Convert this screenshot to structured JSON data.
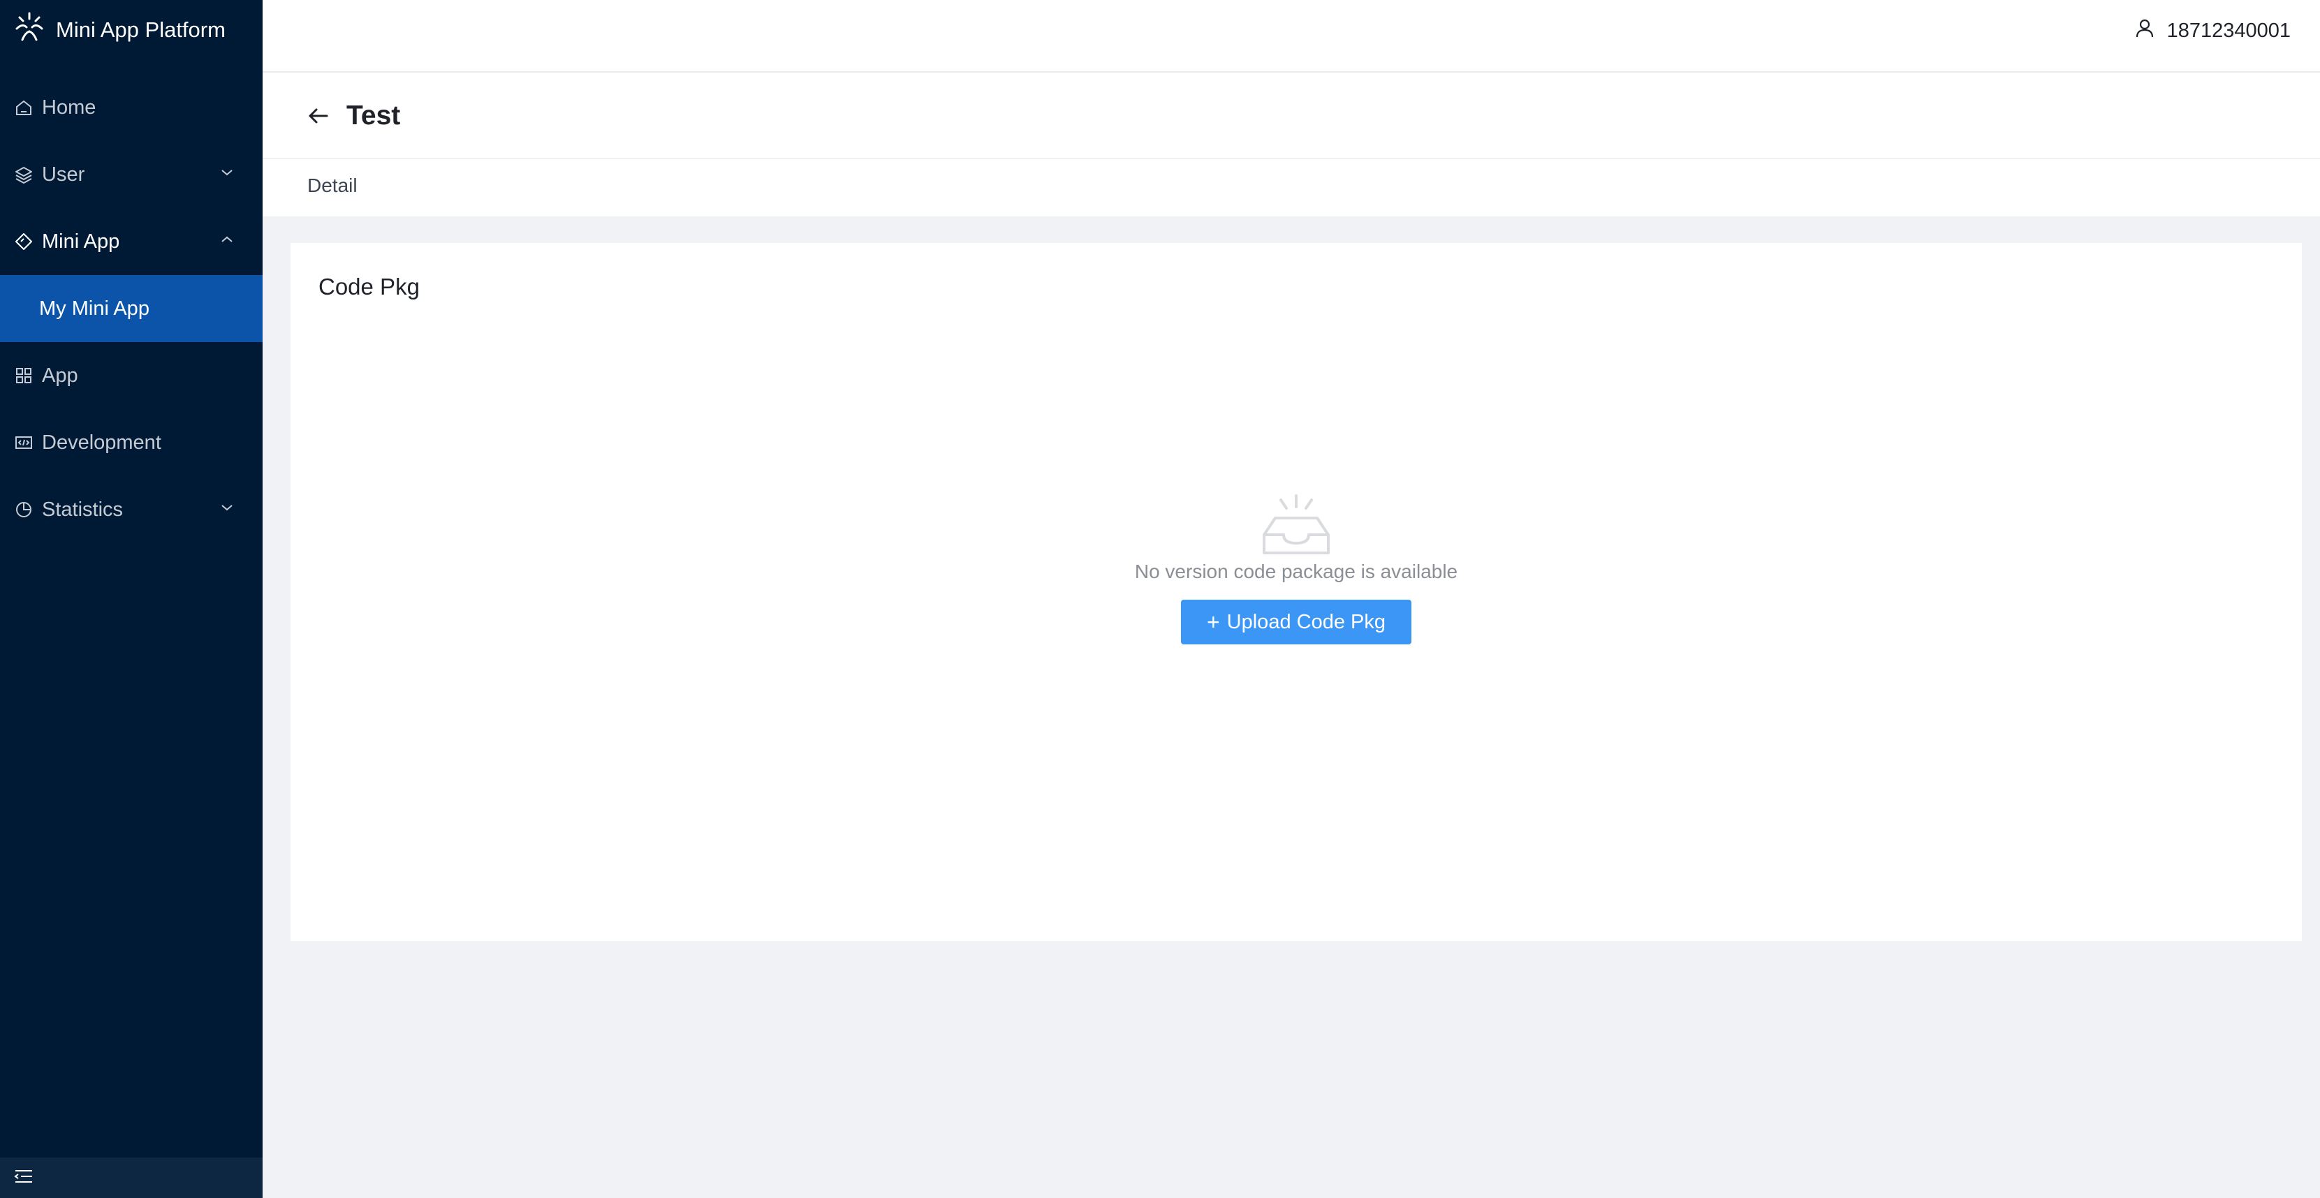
{
  "app": {
    "name": "Mini App Platform"
  },
  "sidebar": {
    "items": [
      {
        "label": "Home",
        "icon": "home-icon"
      },
      {
        "label": "User",
        "icon": "layers-icon",
        "expandable": true
      },
      {
        "label": "Mini App",
        "icon": "diamond-icon",
        "expandable": true,
        "expanded": true,
        "children": [
          {
            "label": "My Mini App",
            "active": true
          }
        ]
      },
      {
        "label": "App",
        "icon": "grid-icon"
      },
      {
        "label": "Development",
        "icon": "code-icon"
      },
      {
        "label": "Statistics",
        "icon": "pie-chart-icon",
        "expandable": true
      }
    ]
  },
  "header": {
    "user": "18712340001"
  },
  "page": {
    "title": "Test",
    "tab": "Detail"
  },
  "card": {
    "title": "Code Pkg",
    "empty_text": "No version code package is available",
    "upload_label": "Upload Code Pkg"
  },
  "colors": {
    "sidebar_bg": "#001a35",
    "active_item": "#0b54a9",
    "primary_button": "#3b96f5",
    "page_bg": "#f0f2f5"
  }
}
